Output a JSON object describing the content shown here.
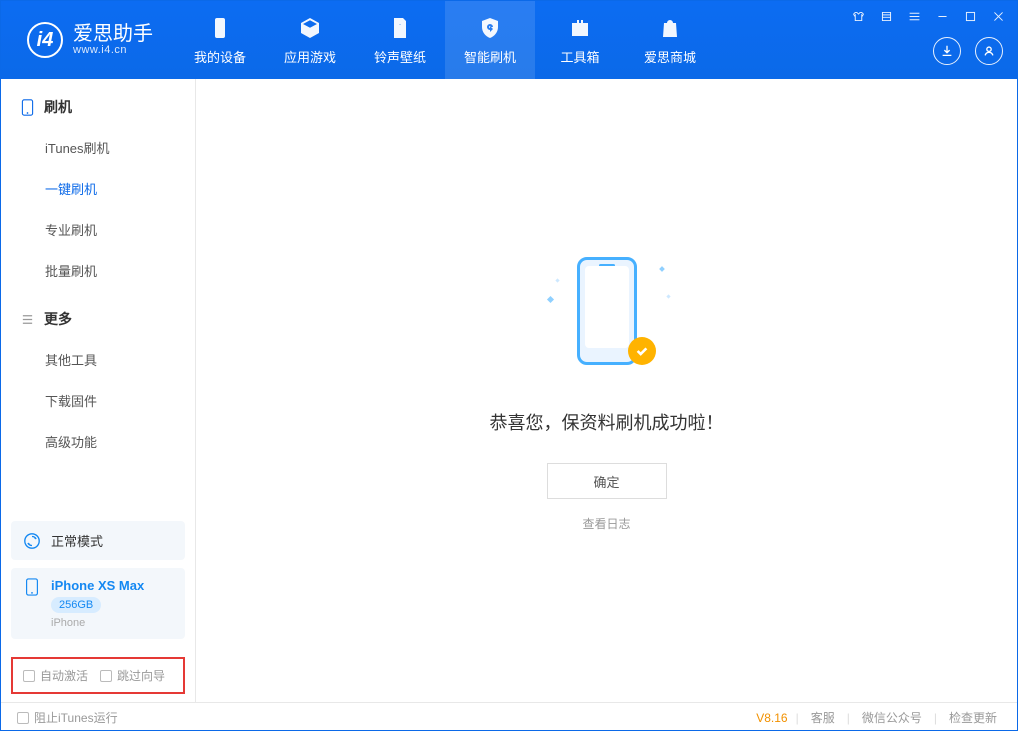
{
  "app": {
    "title": "爱思助手",
    "url": "www.i4.cn"
  },
  "tabs": [
    {
      "label": "我的设备"
    },
    {
      "label": "应用游戏"
    },
    {
      "label": "铃声壁纸"
    },
    {
      "label": "智能刷机"
    },
    {
      "label": "工具箱"
    },
    {
      "label": "爱思商城"
    }
  ],
  "sidebar": {
    "section1": {
      "title": "刷机",
      "items": [
        {
          "label": "iTunes刷机"
        },
        {
          "label": "一键刷机"
        },
        {
          "label": "专业刷机"
        },
        {
          "label": "批量刷机"
        }
      ]
    },
    "section2": {
      "title": "更多",
      "items": [
        {
          "label": "其他工具"
        },
        {
          "label": "下载固件"
        },
        {
          "label": "高级功能"
        }
      ]
    }
  },
  "device_mode": {
    "label": "正常模式"
  },
  "device": {
    "name": "iPhone XS Max",
    "storage": "256GB",
    "type": "iPhone"
  },
  "options": {
    "auto_activate": "自动激活",
    "skip_wizard": "跳过向导"
  },
  "main": {
    "success_text": "恭喜您，保资料刷机成功啦！",
    "ok_button": "确定",
    "view_log": "查看日志"
  },
  "footer": {
    "block_itunes": "阻止iTunes运行",
    "version": "V8.16",
    "support": "客服",
    "wechat": "微信公众号",
    "check_update": "检查更新"
  }
}
